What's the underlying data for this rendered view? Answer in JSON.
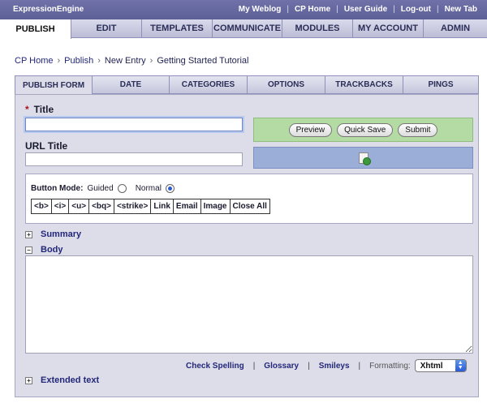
{
  "app": {
    "brand": "ExpressionEngine"
  },
  "toplinks": [
    "My Weblog",
    "CP Home",
    "User Guide",
    "Log-out",
    "New Tab"
  ],
  "mainnav": [
    "PUBLISH",
    "EDIT",
    "TEMPLATES",
    "COMMUNICATE",
    "MODULES",
    "MY ACCOUNT",
    "ADMIN"
  ],
  "breadcrumb": [
    "CP Home",
    "Publish",
    "New Entry",
    "Getting Started Tutorial"
  ],
  "formtabs": [
    "PUBLISH FORM",
    "DATE",
    "CATEGORIES",
    "OPTIONS",
    "TRACKBACKS",
    "PINGS"
  ],
  "form": {
    "required_mark": "*",
    "title_label": "Title",
    "title_value": "",
    "url_title_label": "URL Title",
    "url_title_value": "",
    "preview_label": "Preview",
    "quicksave_label": "Quick Save",
    "submit_label": "Submit"
  },
  "button_mode": {
    "label": "Button Mode:",
    "guided": "Guided",
    "normal": "Normal",
    "selected": "Normal",
    "tags": [
      "<b>",
      "<i>",
      "<u>",
      "<bq>",
      "<strike>",
      "Link",
      "Email",
      "Image",
      "Close All"
    ]
  },
  "sections": {
    "summary": "Summary",
    "body": "Body",
    "extended": "Extended text"
  },
  "bottom": {
    "check_spelling": "Check Spelling",
    "glossary": "Glossary",
    "smileys": "Smileys",
    "formatting_label": "Formatting:",
    "formatting_value": "Xhtml",
    "sep": "|"
  },
  "colors": {
    "topbar": "#6f71a8",
    "accent_green": "#b5dba4",
    "accent_blue": "#9aaed8",
    "required": "#b0101e"
  }
}
